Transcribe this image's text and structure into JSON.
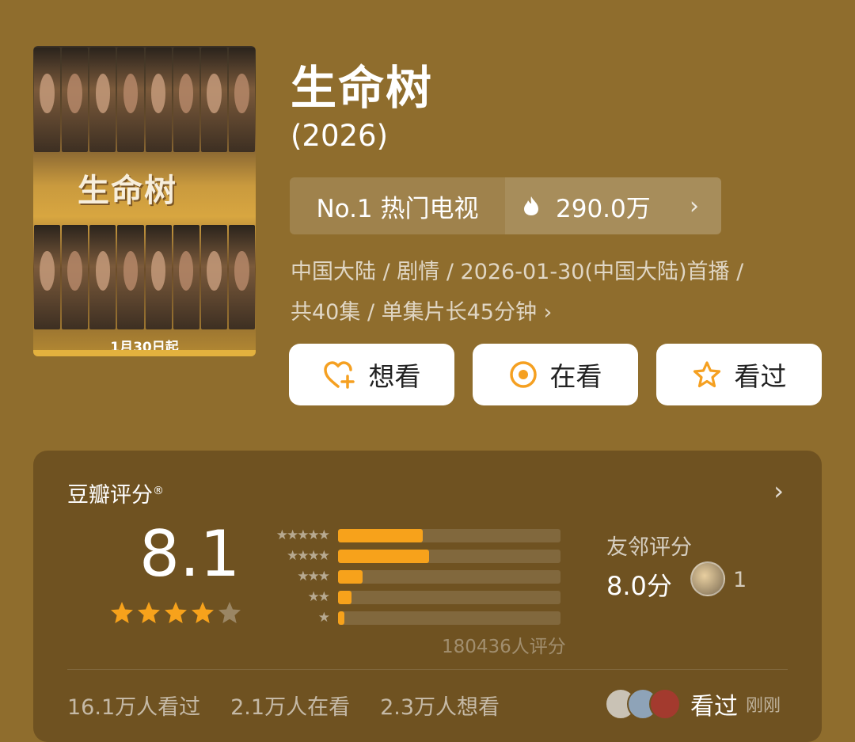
{
  "poster": {
    "title_art": "生命树",
    "date_art": "1月30日起"
  },
  "show": {
    "title": "生命树",
    "year": "(2026)"
  },
  "rank": {
    "label": "No.1 热门电视",
    "heat": "290.0万"
  },
  "meta": {
    "line1": "中国大陆 / 剧情 / 2026-01-30(中国大陆)首播 /",
    "line2": "共40集 / 单集片长45分钟 ›"
  },
  "actions": {
    "want": "想看",
    "watching": "在看",
    "watched": "看过"
  },
  "rating": {
    "title": "豆瓣评分",
    "registered": "®",
    "score": "8.1",
    "stars_filled": 4,
    "stars_total": 5,
    "distribution": [
      {
        "stars": "★★★★★",
        "percent": 38
      },
      {
        "stars": "★★★★",
        "percent": 41
      },
      {
        "stars": "★★★",
        "percent": 11
      },
      {
        "stars": "★★",
        "percent": 6
      },
      {
        "stars": "★",
        "percent": 3
      }
    ],
    "count_text": "180436人评分",
    "friends_title": "友邻评分",
    "friends_score": "8.0分",
    "friends_count": "1"
  },
  "stats": {
    "watched": "16.1万人看过",
    "watching": "2.1万人在看",
    "want": "2.3万人想看"
  },
  "recent": {
    "label": "看过",
    "time": "刚刚"
  },
  "colors": {
    "background": "#8f6d2d",
    "card": "#6f5221",
    "accent": "#f7a21b"
  }
}
